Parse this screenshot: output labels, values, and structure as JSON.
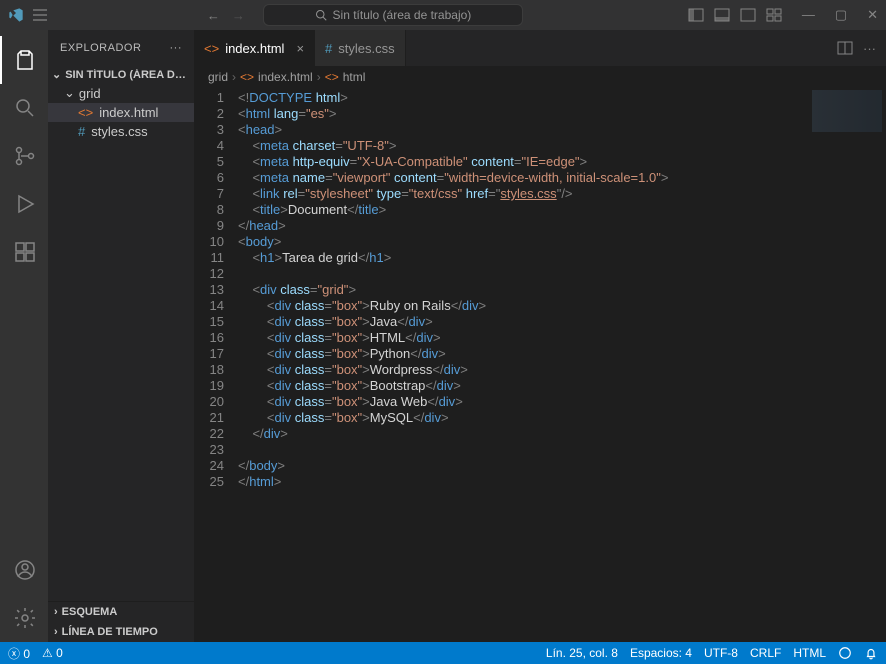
{
  "titlebar": {
    "search_placeholder": "Sin título (área de trabajo)"
  },
  "sidebar": {
    "title": "EXPLORADOR",
    "workspace_label": "SIN TÍTULO (ÁREA DE TRA...",
    "folder": "grid",
    "files": [
      {
        "name": "index.html",
        "active": true,
        "icon": "html"
      },
      {
        "name": "styles.css",
        "active": false,
        "icon": "css"
      }
    ],
    "panels": [
      {
        "label": "ESQUEMA"
      },
      {
        "label": "LÍNEA DE TIEMPO"
      }
    ]
  },
  "tabs": [
    {
      "label": "index.html",
      "active": true,
      "icon": "html"
    },
    {
      "label": "styles.css",
      "active": false,
      "icon": "css"
    }
  ],
  "breadcrumb": {
    "parts": [
      "grid",
      "index.html",
      "html"
    ]
  },
  "code": [
    {
      "n": 1,
      "indent": 0,
      "html": "<span class='tk-punct'>&lt;!</span><span class='tk-doctype'>DOCTYPE</span> <span class='tk-attr'>html</span><span class='tk-punct'>&gt;</span>"
    },
    {
      "n": 2,
      "indent": 0,
      "html": "<span class='tk-punct'>&lt;</span><span class='tk-tag'>html</span> <span class='tk-attr'>lang</span><span class='tk-punct'>=</span><span class='tk-str'>\"es\"</span><span class='tk-punct'>&gt;</span>"
    },
    {
      "n": 3,
      "indent": 0,
      "html": "<span class='tk-punct'>&lt;</span><span class='tk-tag'>head</span><span class='tk-punct'>&gt;</span>"
    },
    {
      "n": 4,
      "indent": 1,
      "html": "<span class='tk-punct'>&lt;</span><span class='tk-tag'>meta</span> <span class='tk-attr'>charset</span><span class='tk-punct'>=</span><span class='tk-str'>\"UTF-8\"</span><span class='tk-punct'>&gt;</span>"
    },
    {
      "n": 5,
      "indent": 1,
      "html": "<span class='tk-punct'>&lt;</span><span class='tk-tag'>meta</span> <span class='tk-attr'>http-equiv</span><span class='tk-punct'>=</span><span class='tk-str'>\"X-UA-Compatible\"</span> <span class='tk-attr'>content</span><span class='tk-punct'>=</span><span class='tk-str'>\"IE=edge\"</span><span class='tk-punct'>&gt;</span>"
    },
    {
      "n": 6,
      "indent": 1,
      "html": "<span class='tk-punct'>&lt;</span><span class='tk-tag'>meta</span> <span class='tk-attr'>name</span><span class='tk-punct'>=</span><span class='tk-str'>\"viewport\"</span> <span class='tk-attr'>content</span><span class='tk-punct'>=</span><span class='tk-str'>\"width=device-width, initial-scale=1.0\"</span><span class='tk-punct'>&gt;</span>"
    },
    {
      "n": 7,
      "indent": 1,
      "html": "<span class='tk-punct'>&lt;</span><span class='tk-tag'>link</span> <span class='tk-attr'>rel</span><span class='tk-punct'>=</span><span class='tk-str'>\"stylesheet\"</span> <span class='tk-attr'>type</span><span class='tk-punct'>=</span><span class='tk-str'>\"text/css\"</span> <span class='tk-attr'>href</span><span class='tk-punct'>=</span><span class='tk-punct'>\"</span><span class='tk-link'>styles.css</span><span class='tk-punct'>\"</span><span class='tk-punct'>/&gt;</span>"
    },
    {
      "n": 8,
      "indent": 1,
      "html": "<span class='tk-punct'>&lt;</span><span class='tk-tag'>title</span><span class='tk-punct'>&gt;</span><span class='tk-text'>Document</span><span class='tk-punct'>&lt;/</span><span class='tk-tag'>title</span><span class='tk-punct'>&gt;</span>"
    },
    {
      "n": 9,
      "indent": 0,
      "html": "<span class='tk-punct'>&lt;/</span><span class='tk-tag'>head</span><span class='tk-punct'>&gt;</span>"
    },
    {
      "n": 10,
      "indent": 0,
      "html": "<span class='tk-punct'>&lt;</span><span class='tk-tag'>body</span><span class='tk-punct'>&gt;</span>"
    },
    {
      "n": 11,
      "indent": 1,
      "html": "<span class='tk-punct'>&lt;</span><span class='tk-tag'>h1</span><span class='tk-punct'>&gt;</span><span class='tk-text'>Tarea de grid</span><span class='tk-punct'>&lt;/</span><span class='tk-tag'>h1</span><span class='tk-punct'>&gt;</span>"
    },
    {
      "n": 12,
      "indent": 0,
      "html": ""
    },
    {
      "n": 13,
      "indent": 1,
      "html": "<span class='tk-punct'>&lt;</span><span class='tk-tag'>div</span> <span class='tk-attr'>class</span><span class='tk-punct'>=</span><span class='tk-str'>\"grid\"</span><span class='tk-punct'>&gt;</span>"
    },
    {
      "n": 14,
      "indent": 2,
      "html": "<span class='tk-punct'>&lt;</span><span class='tk-tag'>div</span> <span class='tk-attr'>class</span><span class='tk-punct'>=</span><span class='tk-str'>\"box\"</span><span class='tk-punct'>&gt;</span><span class='tk-text'>Ruby on Rails</span><span class='tk-punct'>&lt;/</span><span class='tk-tag'>div</span><span class='tk-punct'>&gt;</span>"
    },
    {
      "n": 15,
      "indent": 2,
      "html": "<span class='tk-punct'>&lt;</span><span class='tk-tag'>div</span> <span class='tk-attr'>class</span><span class='tk-punct'>=</span><span class='tk-str'>\"box\"</span><span class='tk-punct'>&gt;</span><span class='tk-text'>Java</span><span class='tk-punct'>&lt;/</span><span class='tk-tag'>div</span><span class='tk-punct'>&gt;</span>"
    },
    {
      "n": 16,
      "indent": 2,
      "html": "<span class='tk-punct'>&lt;</span><span class='tk-tag'>div</span> <span class='tk-attr'>class</span><span class='tk-punct'>=</span><span class='tk-str'>\"box\"</span><span class='tk-punct'>&gt;</span><span class='tk-text'>HTML</span><span class='tk-punct'>&lt;/</span><span class='tk-tag'>div</span><span class='tk-punct'>&gt;</span>"
    },
    {
      "n": 17,
      "indent": 2,
      "html": "<span class='tk-punct'>&lt;</span><span class='tk-tag'>div</span> <span class='tk-attr'>class</span><span class='tk-punct'>=</span><span class='tk-str'>\"box\"</span><span class='tk-punct'>&gt;</span><span class='tk-text'>Python</span><span class='tk-punct'>&lt;/</span><span class='tk-tag'>div</span><span class='tk-punct'>&gt;</span>"
    },
    {
      "n": 18,
      "indent": 2,
      "html": "<span class='tk-punct'>&lt;</span><span class='tk-tag'>div</span> <span class='tk-attr'>class</span><span class='tk-punct'>=</span><span class='tk-str'>\"box\"</span><span class='tk-punct'>&gt;</span><span class='tk-text'>Wordpress</span><span class='tk-punct'>&lt;/</span><span class='tk-tag'>div</span><span class='tk-punct'>&gt;</span>"
    },
    {
      "n": 19,
      "indent": 2,
      "html": "<span class='tk-punct'>&lt;</span><span class='tk-tag'>div</span> <span class='tk-attr'>class</span><span class='tk-punct'>=</span><span class='tk-str'>\"box\"</span><span class='tk-punct'>&gt;</span><span class='tk-text'>Bootstrap</span><span class='tk-punct'>&lt;/</span><span class='tk-tag'>div</span><span class='tk-punct'>&gt;</span>"
    },
    {
      "n": 20,
      "indent": 2,
      "html": "<span class='tk-punct'>&lt;</span><span class='tk-tag'>div</span> <span class='tk-attr'>class</span><span class='tk-punct'>=</span><span class='tk-str'>\"box\"</span><span class='tk-punct'>&gt;</span><span class='tk-text'>Java Web</span><span class='tk-punct'>&lt;/</span><span class='tk-tag'>div</span><span class='tk-punct'>&gt;</span>"
    },
    {
      "n": 21,
      "indent": 2,
      "html": "<span class='tk-punct'>&lt;</span><span class='tk-tag'>div</span> <span class='tk-attr'>class</span><span class='tk-punct'>=</span><span class='tk-str'>\"box\"</span><span class='tk-punct'>&gt;</span><span class='tk-text'>MySQL</span><span class='tk-punct'>&lt;/</span><span class='tk-tag'>div</span><span class='tk-punct'>&gt;</span>"
    },
    {
      "n": 22,
      "indent": 1,
      "html": "<span class='tk-punct'>&lt;/</span><span class='tk-tag'>div</span><span class='tk-punct'>&gt;</span>"
    },
    {
      "n": 23,
      "indent": 0,
      "html": ""
    },
    {
      "n": 24,
      "indent": 0,
      "html": "<span class='tk-punct'>&lt;/</span><span class='tk-tag'>body</span><span class='tk-punct'>&gt;</span>"
    },
    {
      "n": 25,
      "indent": 0,
      "html": "<span class='tk-punct'>&lt;/</span><span class='tk-tag'>html</span><span class='tk-punct'>&gt;</span>"
    }
  ],
  "status": {
    "errors": "0",
    "warnings": "0",
    "cursor": "Lín. 25, col. 8",
    "spaces": "Espacios: 4",
    "encoding": "UTF-8",
    "eol": "CRLF",
    "lang": "HTML"
  }
}
